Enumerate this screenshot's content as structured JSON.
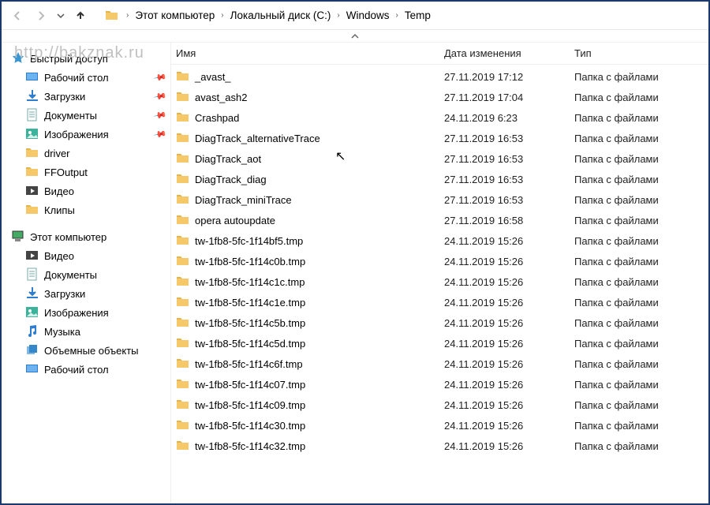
{
  "watermark": "http://bakznak.ru",
  "breadcrumb": {
    "items": [
      "Этот компьютер",
      "Локальный диск (C:)",
      "Windows",
      "Temp"
    ]
  },
  "columns": {
    "name": "Имя",
    "date": "Дата изменения",
    "type": "Тип"
  },
  "sidebar": {
    "quick": {
      "label": "Быстрый доступ",
      "items": [
        {
          "label": "Рабочий стол",
          "pinned": true,
          "icon": "desktop"
        },
        {
          "label": "Загрузки",
          "pinned": true,
          "icon": "downloads"
        },
        {
          "label": "Документы",
          "pinned": true,
          "icon": "documents"
        },
        {
          "label": "Изображения",
          "pinned": true,
          "icon": "pictures"
        },
        {
          "label": "driver",
          "pinned": false,
          "icon": "folder"
        },
        {
          "label": "FFOutput",
          "pinned": false,
          "icon": "folder"
        },
        {
          "label": "Видео",
          "pinned": false,
          "icon": "video"
        },
        {
          "label": "Клипы",
          "pinned": false,
          "icon": "folder"
        }
      ]
    },
    "thispc": {
      "label": "Этот компьютер",
      "items": [
        {
          "label": "Видео",
          "icon": "video"
        },
        {
          "label": "Документы",
          "icon": "documents"
        },
        {
          "label": "Загрузки",
          "icon": "downloads"
        },
        {
          "label": "Изображения",
          "icon": "pictures"
        },
        {
          "label": "Музыка",
          "icon": "music"
        },
        {
          "label": "Объемные объекты",
          "icon": "3d"
        },
        {
          "label": "Рабочий стол",
          "icon": "desktop"
        }
      ]
    }
  },
  "type_folder": "Папка с файлами",
  "files": [
    {
      "name": "_avast_",
      "date": "27.11.2019 17:12"
    },
    {
      "name": "avast_ash2",
      "date": "27.11.2019 17:04"
    },
    {
      "name": "Crashpad",
      "date": "24.11.2019 6:23"
    },
    {
      "name": "DiagTrack_alternativeTrace",
      "date": "27.11.2019 16:53"
    },
    {
      "name": "DiagTrack_aot",
      "date": "27.11.2019 16:53"
    },
    {
      "name": "DiagTrack_diag",
      "date": "27.11.2019 16:53"
    },
    {
      "name": "DiagTrack_miniTrace",
      "date": "27.11.2019 16:53"
    },
    {
      "name": "opera autoupdate",
      "date": "27.11.2019 16:58"
    },
    {
      "name": "tw-1fb8-5fc-1f14bf5.tmp",
      "date": "24.11.2019 15:26"
    },
    {
      "name": "tw-1fb8-5fc-1f14c0b.tmp",
      "date": "24.11.2019 15:26"
    },
    {
      "name": "tw-1fb8-5fc-1f14c1c.tmp",
      "date": "24.11.2019 15:26"
    },
    {
      "name": "tw-1fb8-5fc-1f14c1e.tmp",
      "date": "24.11.2019 15:26"
    },
    {
      "name": "tw-1fb8-5fc-1f14c5b.tmp",
      "date": "24.11.2019 15:26"
    },
    {
      "name": "tw-1fb8-5fc-1f14c5d.tmp",
      "date": "24.11.2019 15:26"
    },
    {
      "name": "tw-1fb8-5fc-1f14c6f.tmp",
      "date": "24.11.2019 15:26"
    },
    {
      "name": "tw-1fb8-5fc-1f14c07.tmp",
      "date": "24.11.2019 15:26"
    },
    {
      "name": "tw-1fb8-5fc-1f14c09.tmp",
      "date": "24.11.2019 15:26"
    },
    {
      "name": "tw-1fb8-5fc-1f14c30.tmp",
      "date": "24.11.2019 15:26"
    },
    {
      "name": "tw-1fb8-5fc-1f14c32.tmp",
      "date": "24.11.2019 15:26"
    }
  ]
}
